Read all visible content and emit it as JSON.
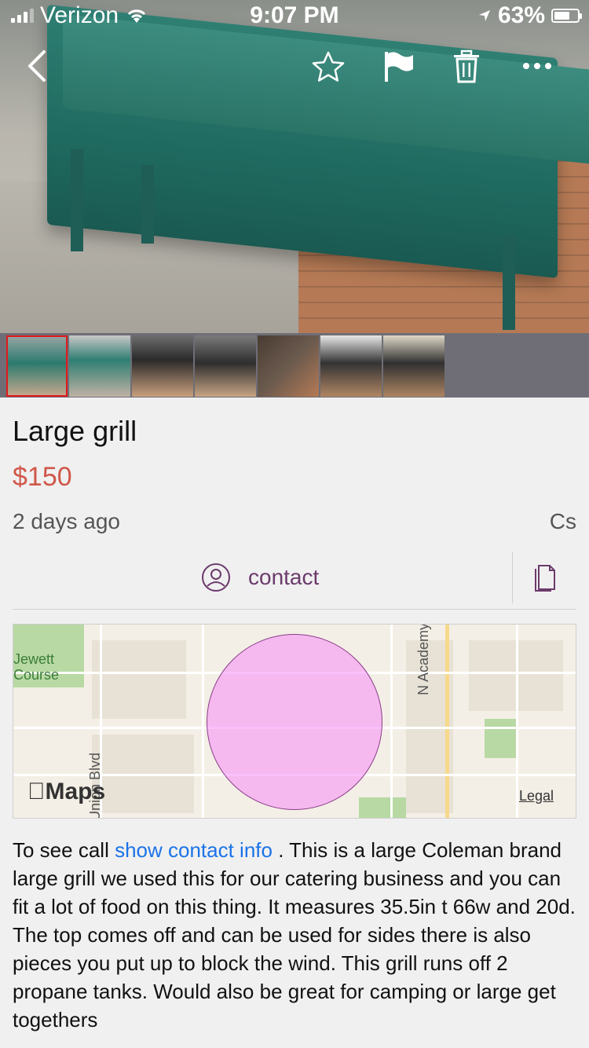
{
  "status_bar": {
    "carrier": "Verizon",
    "time": "9:07 PM",
    "battery": "63%",
    "battery_level": 0.63
  },
  "nav": {
    "icons": [
      "back-icon",
      "star-icon",
      "flag-icon",
      "trash-icon",
      "more-icon"
    ]
  },
  "thumbnails": {
    "count": 7,
    "selected_index": 0
  },
  "listing": {
    "title": "Large grill",
    "price": "$150",
    "age": "2 days ago",
    "poster": "Cs"
  },
  "actions": {
    "contact_label": "contact"
  },
  "map": {
    "labels": {
      "golf": "Jewett\nCourse",
      "street1": "N Academy Blvd",
      "street2": "Union Blvd",
      "maps": "Maps",
      "legal": "Legal"
    }
  },
  "description": {
    "prefix": "To see call ",
    "link": "show contact info",
    "body": " . This is a large Coleman brand large grill we used this for our catering business and you can fit a lot of food on this thing. It measures 35.5in t 66w and 20d. The top comes off and can be used for sides there is also pieces you put up to block the wind. This grill runs off 2 propane tanks. Would also be great for camping or large get togethers"
  },
  "colors": {
    "price": "#d0574a",
    "link": "#1a73e8",
    "accent": "#6b3a6b",
    "selected_thumb_border": "#e0191b"
  }
}
